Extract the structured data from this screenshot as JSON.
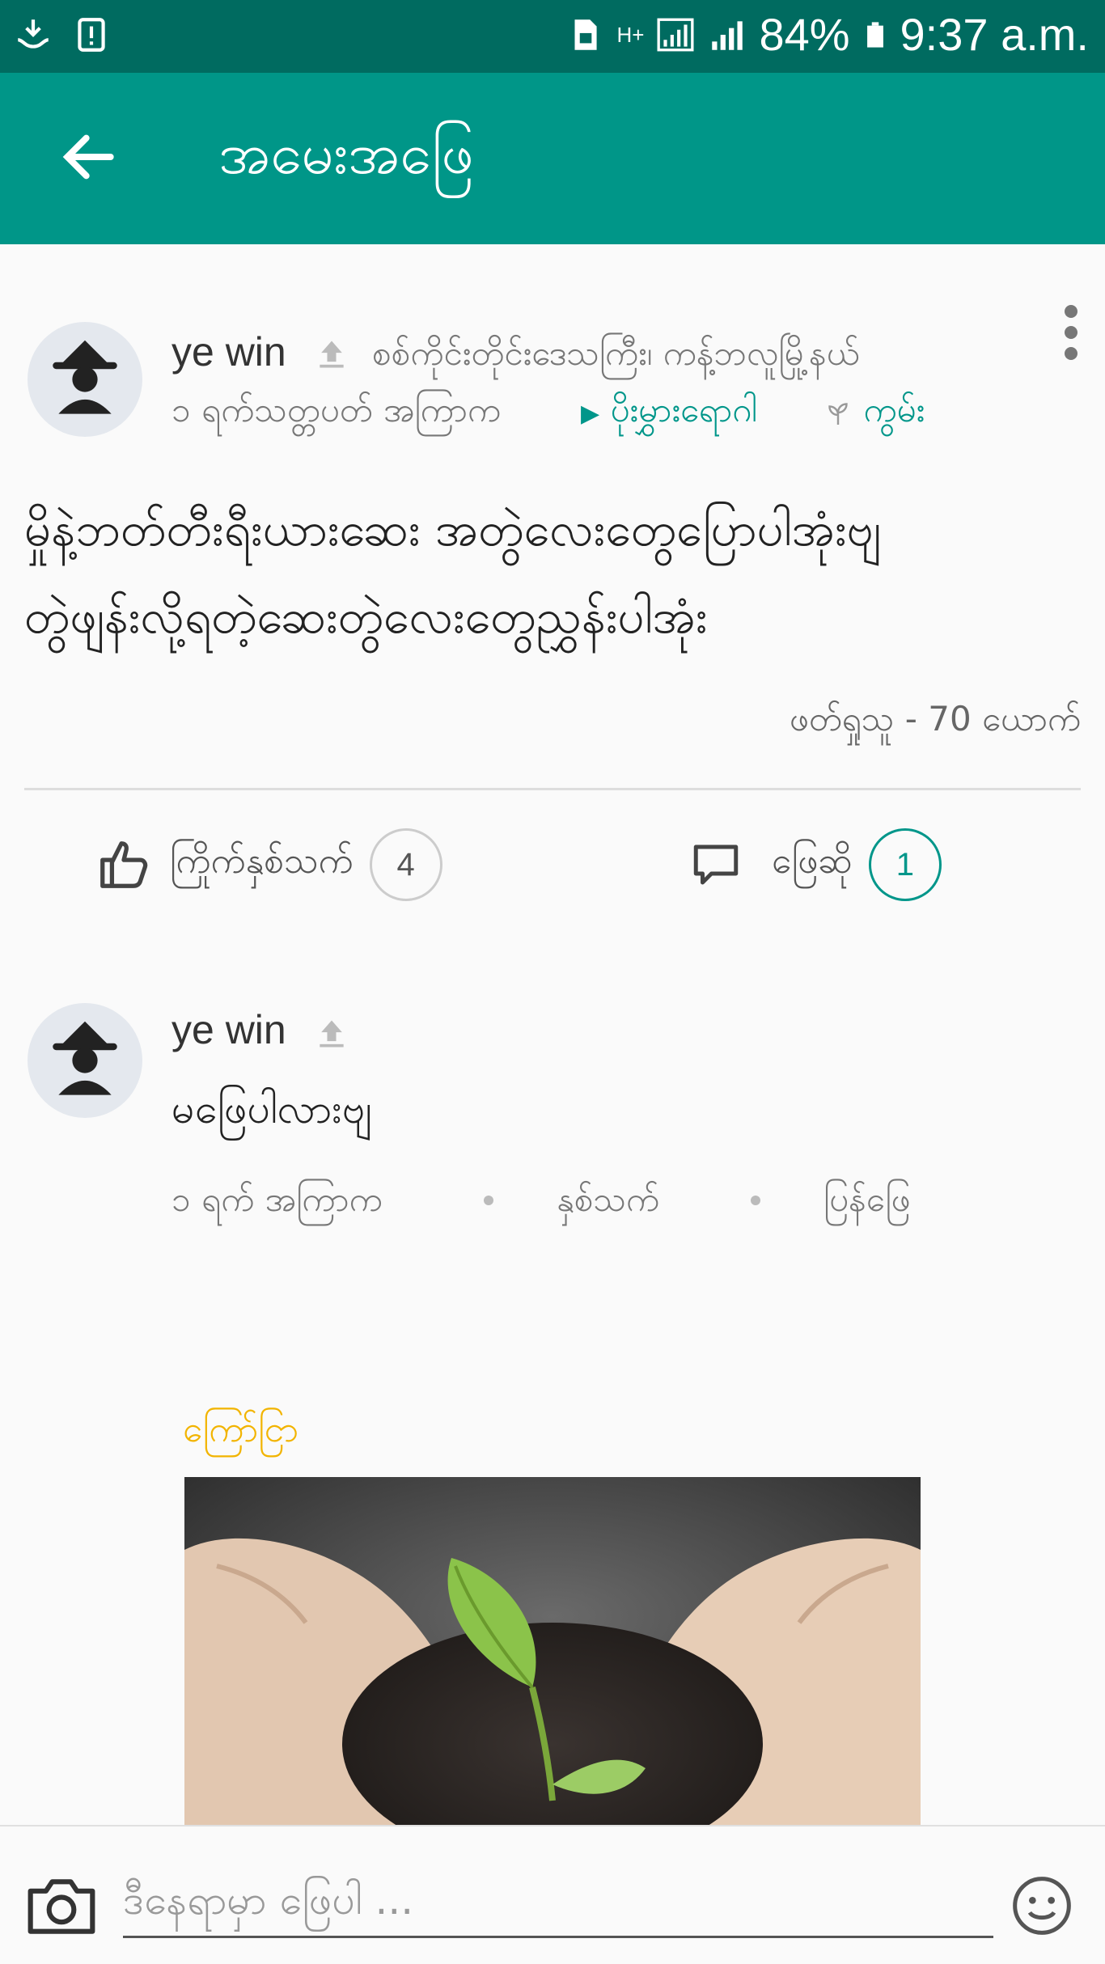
{
  "status_bar": {
    "battery": "84%",
    "time": "9:37 a.m.",
    "network": "H+"
  },
  "appbar": {
    "title": "အမေးအဖြေ"
  },
  "post": {
    "author": "ye win",
    "location": "စစ်ကိုင်းတိုင်းဒေသကြီး၊ ကန့်ဘလူမြို့နယ်",
    "time_ago": "၁ ရက်သတ္တပတ် အကြာက",
    "category": "ပိုးမွှားရောဂါ",
    "crop": "ကွမ်း",
    "body_line1": "မှိုနဲ့ဘတ်တီးရီးယားဆေး အတွဲလေးတွေပြောပါအုံးဗျ",
    "body_line2": "တွဲဖျန်းလို့ရတဲ့ဆေးတွဲလေးတွေညွှန်းပါအုံး",
    "views": "ဖတ်ရှုသူ - 70 ယောက်",
    "like_label": "ကြိုက်နှစ်သက်",
    "like_count": "4",
    "answer_label": "ဖြေဆို",
    "answer_count": "1"
  },
  "comment": {
    "author": "ye win",
    "text": "မဖြေပါလားဗျ",
    "time_ago": "၁ ရက် အကြာက",
    "like_label": "နှစ်သက်",
    "reply_label": "ပြန်ဖြေ"
  },
  "ad": {
    "label": "ကြော်ငြာ"
  },
  "input": {
    "placeholder": "ဒီနေရာမှာ ဖြေပါ ..."
  },
  "colors": {
    "status_bar": "#006b60",
    "appbar": "#009688",
    "accent": "#00968a",
    "ad_label": "#f2b400"
  }
}
